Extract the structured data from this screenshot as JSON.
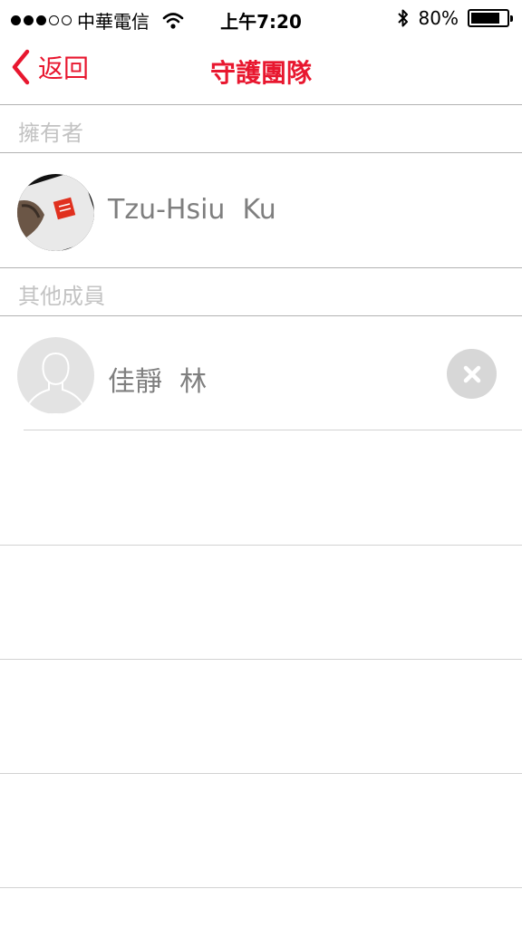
{
  "status_bar": {
    "carrier": "中華電信",
    "time": "上午7:20",
    "battery": "80%",
    "battery_level": 0.8,
    "signal_bars": 3
  },
  "nav": {
    "back_label": "返回",
    "title": "守護團隊"
  },
  "sections": {
    "owner_header": "擁有者",
    "others_header": "其他成員"
  },
  "owner": {
    "name": "Tzu-Hsiu  Ku"
  },
  "members": [
    {
      "name": "佳靜  林"
    }
  ],
  "colors": {
    "accent": "#e8172f",
    "header_text": "#c3c3c3",
    "name_text": "#7f7f7f",
    "separator": "#b2b2b2",
    "remove_button": "#d7d7d7"
  },
  "icons": {
    "back": "chevron-left-icon",
    "remove": "close-icon",
    "default_avatar": "person-silhouette-icon",
    "wifi": "wifi-icon",
    "bluetooth": "bluetooth-icon",
    "battery": "battery-icon"
  }
}
